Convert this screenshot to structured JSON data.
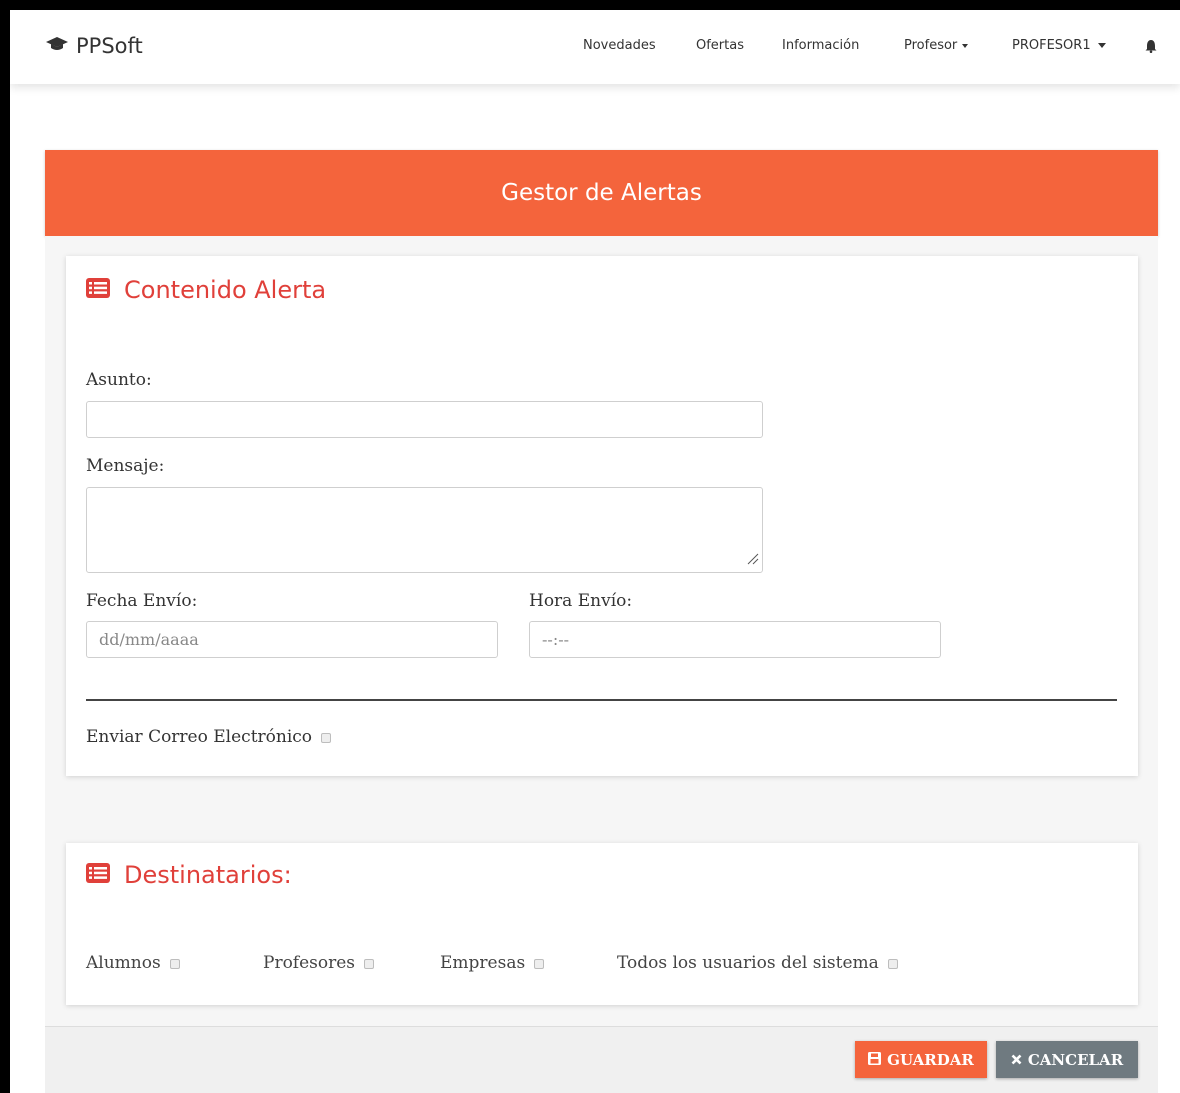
{
  "brand": {
    "name": "PPSoft",
    "icon": "graduation-cap-icon"
  },
  "nav": {
    "novedades": "Novedades",
    "ofertas": "Ofertas",
    "informacion": "Información",
    "profesor": "Profesor",
    "user": "PROFESOR1",
    "bell_icon": "bell-icon"
  },
  "panel": {
    "title": "Gestor de Alertas"
  },
  "contenido": {
    "title": "Contenido Alerta",
    "icon": "list-alt-icon",
    "asunto_label": "Asunto:",
    "asunto_value": "",
    "mensaje_label": "Mensaje:",
    "mensaje_value": "",
    "fecha_label": "Fecha Envío:",
    "fecha_placeholder": "dd/mm/aaaa",
    "hora_label": "Hora Envío:",
    "hora_placeholder": "--:--",
    "correo_label": "Enviar Correo Electrónico"
  },
  "destinatarios": {
    "title": "Destinatarios:",
    "icon": "list-alt-icon",
    "options": [
      "Alumnos",
      "Profesores",
      "Empresas",
      "Todos los usuarios del sistema"
    ]
  },
  "actions": {
    "save": "GUARDAR",
    "cancel": "CANCELAR"
  },
  "colors": {
    "accent": "#f4643c",
    "title_red": "#e0403a",
    "cancel_gray": "#6f7a80"
  }
}
